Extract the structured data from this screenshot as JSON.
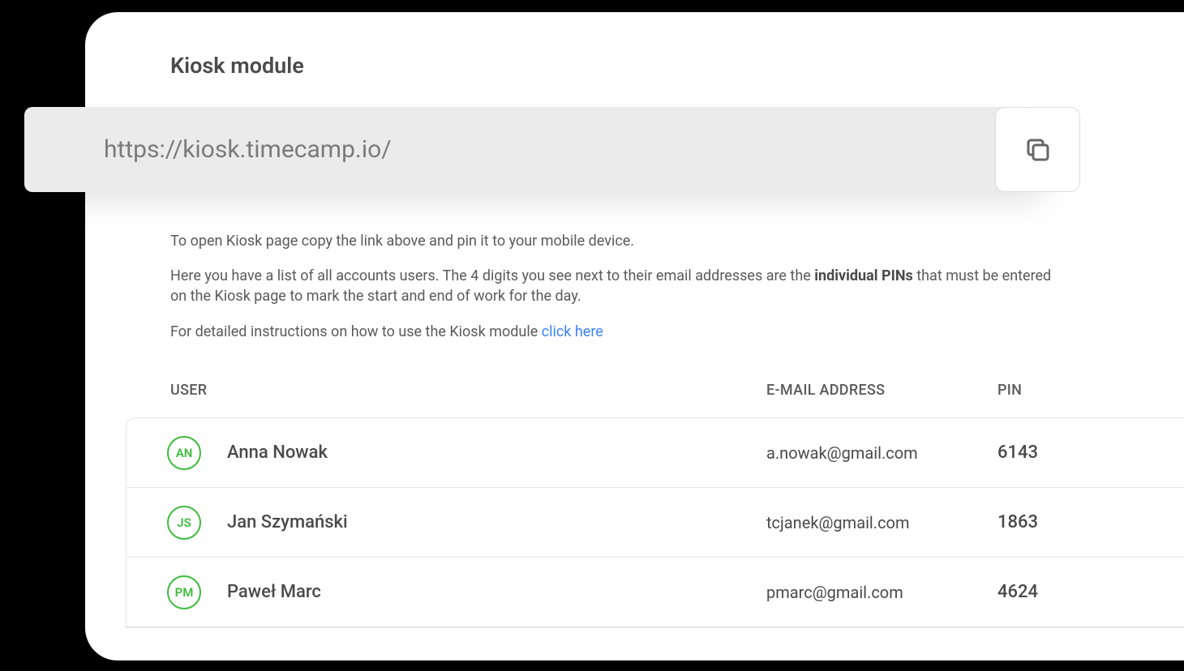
{
  "page_title": "Kiosk module",
  "url": "https://kiosk.timecamp.io/",
  "desc_line1": "To open Kiosk page copy the link above and pin it to your mobile device.",
  "desc_line2a": "Here you have a list of all accounts users. The 4 digits you see next to their email addresses are the ",
  "desc_line2b_bold": "individual PINs",
  "desc_line2c": " that must be entered on the Kiosk page to mark the start and end of work for the day.",
  "desc_line3": "For detailed instructions on how to use the Kiosk module ",
  "click_here": "click here",
  "headers": {
    "user": "USER",
    "email": "E-MAIL ADDRESS",
    "pin": "PIN"
  },
  "rows": [
    {
      "initials": "AN",
      "name": "Anna Nowak",
      "email": "a.nowak@gmail.com",
      "pin": "6143"
    },
    {
      "initials": "JS",
      "name": "Jan Szymański",
      "email": "tcjanek@gmail.com",
      "pin": "1863"
    },
    {
      "initials": "PM",
      "name": "Paweł Marc",
      "email": "pmarc@gmail.com",
      "pin": "4624"
    }
  ]
}
